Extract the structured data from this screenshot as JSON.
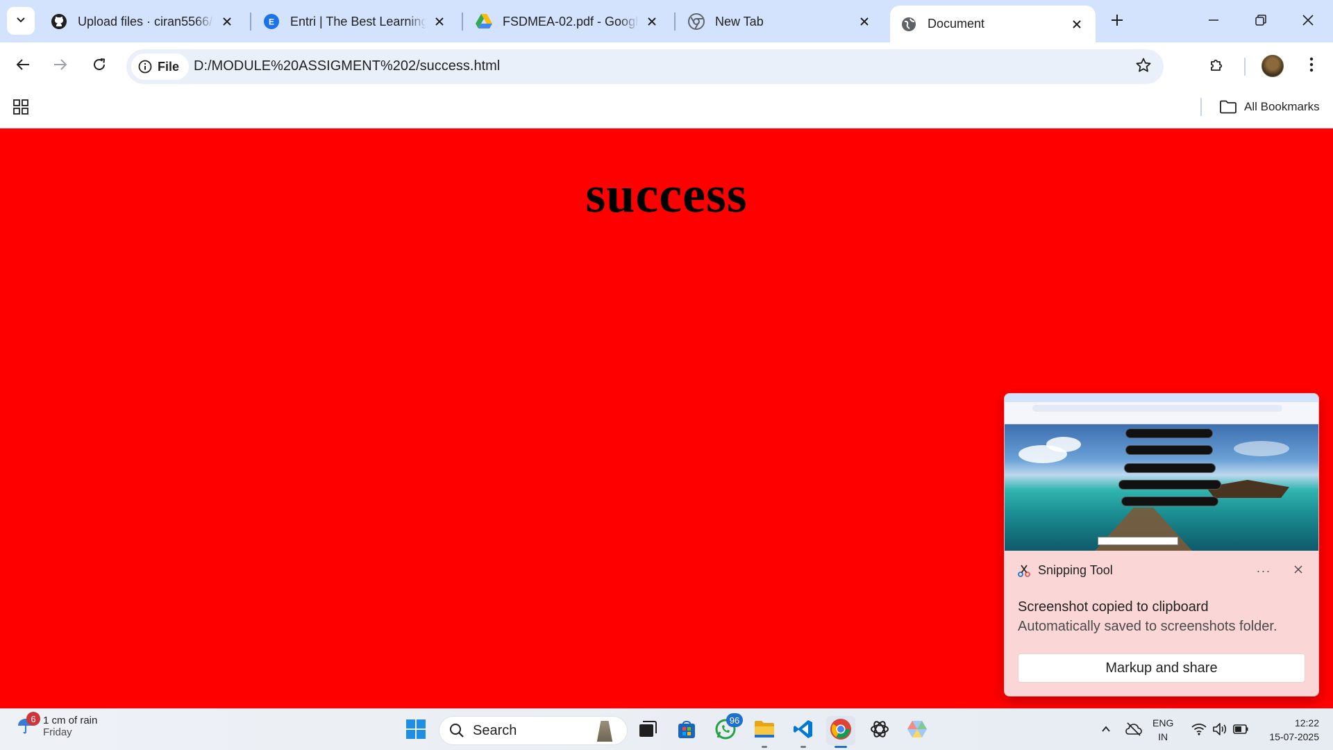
{
  "browser": {
    "tabs": [
      {
        "title": "Upload files · ciran5566/Mo",
        "icon": "github-icon",
        "active": false
      },
      {
        "title": "Entri | The Best Learning ap",
        "icon": "entri-icon",
        "active": false
      },
      {
        "title": "FSDMEA-02.pdf - Google Dri",
        "icon": "google-drive-icon",
        "active": false
      },
      {
        "title": "New Tab",
        "icon": "chrome-icon",
        "active": false
      },
      {
        "title": "Document",
        "icon": "globe-icon",
        "active": true
      }
    ],
    "address": {
      "chip_label": "File",
      "url": "D:/MODULE%20ASSIGMENT%202/success.html"
    },
    "bookmarks": {
      "all_bookmarks_label": "All Bookmarks"
    }
  },
  "page": {
    "heading": "success",
    "background_color": "#ff0000"
  },
  "toast": {
    "app_name": "Snipping Tool",
    "more_label": "···",
    "title": "Screenshot copied to clipboard",
    "subtitle": "Automatically saved to screenshots folder.",
    "button_label": "Markup and share"
  },
  "taskbar": {
    "weather": {
      "badge": "6",
      "line1": "1 cm of rain",
      "line2": "Friday"
    },
    "search_label": "Search",
    "whatsapp_badge": "96",
    "language": {
      "line1": "ENG",
      "line2": "IN"
    },
    "clock": {
      "time": "12:22",
      "date": "15-07-2025"
    }
  },
  "colors": {
    "tabstrip": "#d3e3fd",
    "page_background": "#ff0000",
    "toast_background": "#fbd6d6",
    "accent": "#1f6fd1"
  }
}
